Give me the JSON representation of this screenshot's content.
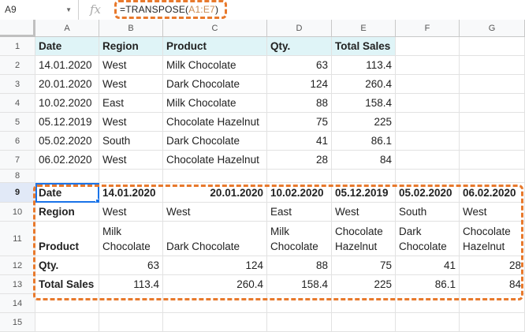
{
  "formula_bar": {
    "name_box": "A9",
    "fx": "fx",
    "formula_prefix": "=TRANSPOSE(",
    "formula_ref": "A1:E7",
    "formula_suffix": ")"
  },
  "columns": [
    "A",
    "B",
    "C",
    "D",
    "E",
    "F",
    "G"
  ],
  "rows": [
    "1",
    "2",
    "3",
    "4",
    "5",
    "6",
    "7",
    "8",
    "9",
    "10",
    "11",
    "12",
    "13",
    "14",
    "15"
  ],
  "source_table": {
    "headers": [
      "Date",
      "Region",
      "Product",
      "Qty.",
      "Total Sales"
    ],
    "rows": [
      [
        "14.01.2020",
        "West",
        "Milk Chocolate",
        "63",
        "113.4"
      ],
      [
        "20.01.2020",
        "West",
        "Dark Chocolate",
        "124",
        "260.4"
      ],
      [
        "10.02.2020",
        "East",
        "Milk Chocolate",
        "88",
        "158.4"
      ],
      [
        "05.12.2019",
        "West",
        "Chocolate Hazelnut",
        "75",
        "225"
      ],
      [
        "05.02.2020",
        "South",
        "Dark Chocolate",
        "41",
        "86.1"
      ],
      [
        "06.02.2020",
        "West",
        "Chocolate Hazelnut",
        "28",
        "84"
      ]
    ]
  },
  "transposed": {
    "date": [
      "Date",
      "14.01.2020",
      "20.01.2020",
      "10.02.2020",
      "05.12.2019",
      "05.02.2020",
      "06.02.2020"
    ],
    "region": [
      "Region",
      "West",
      "West",
      "East",
      "West",
      "South",
      "West"
    ],
    "product": [
      "Product",
      "Milk Chocolate",
      "Dark Chocolate",
      "Milk Chocolate",
      "Chocolate Hazelnut",
      "Dark Chocolate",
      "Chocolate Hazelnut"
    ],
    "qty": [
      "Qty.",
      "63",
      "124",
      "88",
      "75",
      "41",
      "28"
    ],
    "total": [
      "Total Sales",
      "113.4",
      "260.4",
      "158.4",
      "225",
      "86.1",
      "84"
    ]
  },
  "colors": {
    "accent_orange": "#e8792c",
    "header_fill": "#dff4f7",
    "selection_blue": "#1a73e8"
  }
}
